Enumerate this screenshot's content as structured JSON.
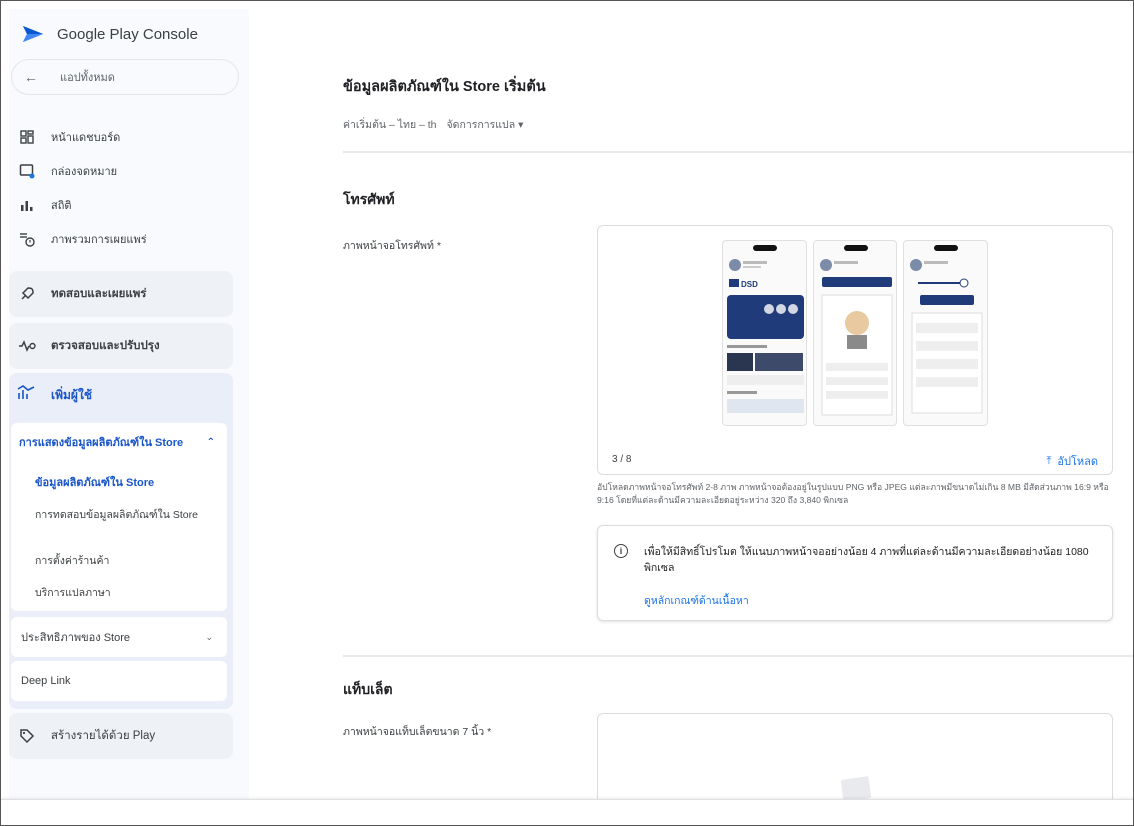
{
  "app": {
    "brand": "Google Play Console",
    "accent": "#1a56c9",
    "link_color": "#1a73e8"
  },
  "sidebar": {
    "back_label": "แอปทั้งหมด",
    "nav": [
      {
        "label": "หน้าแดชบอร์ด",
        "icon": "dashboard-icon"
      },
      {
        "label": "กล่องจดหมาย",
        "icon": "inbox-icon"
      },
      {
        "label": "สถิติ",
        "icon": "bar-chart-icon"
      },
      {
        "label": "ภาพรวมการเผยแพร่",
        "icon": "publishing-overview-icon"
      }
    ],
    "sections": {
      "test_release": "ทดสอบและเผยแพร่",
      "monitor": "ตรวจสอบและปรับปรุง",
      "grow": "เพิ่มผู้ใช้",
      "monetize": "สร้างรายได้ด้วย Play"
    },
    "store_presence": {
      "title": "การแสดงข้อมูลผลิตภัณฑ์ใน Store",
      "items": [
        "ข้อมูลผลิตภัณฑ์ใน Store",
        "การทดสอบข้อมูลผลิตภัณฑ์ใน Store",
        "การตั้งค่าร้านค้า",
        "บริการแปลภาษา"
      ]
    },
    "store_performance": "ประสิทธิภาพของ Store",
    "deep_link": "Deep Link"
  },
  "main": {
    "title": "ข้อมูลผลิตภัณฑ์ใน Store เริ่มต้น",
    "lang_default": "ค่าเริ่มต้น – ไทย – th",
    "lang_manage": "จัดการการแปล",
    "phone": {
      "heading": "โทรศัพท์",
      "label": "ภาพหน้าจอโทรศัพท์ *",
      "counter": "3 / 8",
      "upload_label": "อัปโหลด",
      "helper": "อัปโหลดภาพหน้าจอโทรศัพท์ 2-8 ภาพ ภาพหน้าจอต้องอยู่ในรูปแบบ PNG หรือ JPEG แต่ละภาพมีขนาดไม่เกิน 8 MB มีสัดส่วนภาพ 16:9 หรือ 9:16 โดยที่แต่ละด้านมีความละเอียดอยู่ระหว่าง 320 ถึง 3,840 พิกเซล",
      "info_text": "เพื่อให้มีสิทธิ์โปรโมต ให้แนบภาพหน้าจออย่างน้อย 4 ภาพที่แต่ละด้านมีความละเอียดอย่างน้อย 1080 พิกเซล",
      "info_link": "ดูหลักเกณฑ์ด้านเนื้อหา"
    },
    "tablet": {
      "heading": "แท็บเล็ต",
      "label": "ภาพหน้าจอแท็บเล็ตขนาด 7 นิ้ว *"
    },
    "screenshot_text": {
      "dsd": "DSD"
    }
  }
}
